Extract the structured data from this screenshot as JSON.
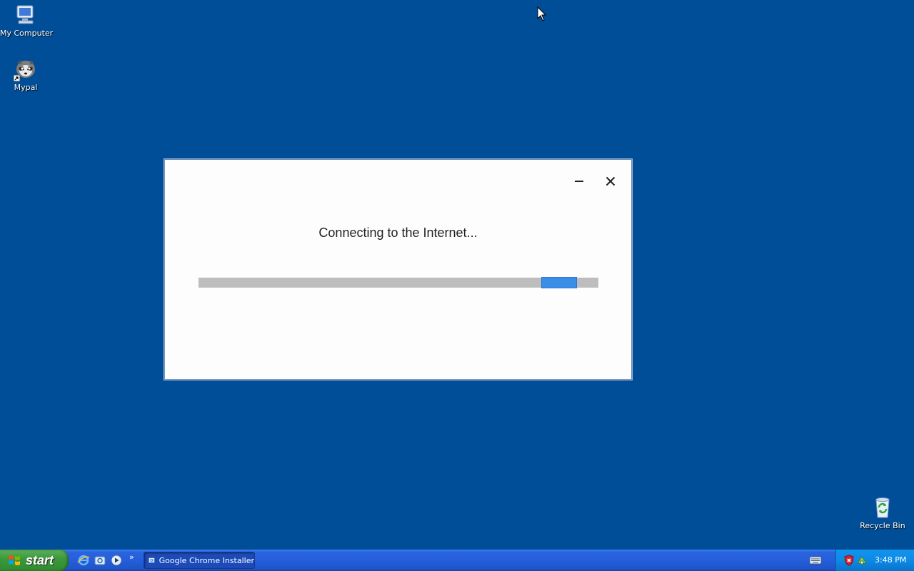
{
  "desktop": {
    "icons": [
      {
        "label": "My Computer",
        "icon": "my-computer-icon"
      },
      {
        "label": "Mypal",
        "icon": "mypal-raccoon-icon"
      },
      {
        "label": "Recycle Bin",
        "icon": "recycle-bin-icon"
      }
    ]
  },
  "dialog": {
    "status_text": "Connecting to the Internet...",
    "minimize_icon": "minimize-icon",
    "close_icon": "close-icon",
    "progress": {
      "mode": "indeterminate",
      "chunk_fraction": 0.9
    }
  },
  "taskbar": {
    "start_label": "start",
    "quick_launch": [
      "internet-explorer-icon",
      "mail-icon",
      "media-player-icon"
    ],
    "overflow": "»",
    "tasks": [
      {
        "label": "Google Chrome Installer",
        "icon": "chrome-installer-icon",
        "active": true
      }
    ],
    "tray": {
      "clock": "3:48 PM",
      "icons": [
        "keyboard-icon",
        "security-shield-icon",
        "network-icon"
      ]
    }
  },
  "colors": {
    "desktop_bg": "#004e98",
    "taskbar_blue": "#245edb",
    "start_green": "#3c9a3c",
    "progress_blue": "#3b8ee8",
    "progress_track": "#bdbdbd"
  }
}
